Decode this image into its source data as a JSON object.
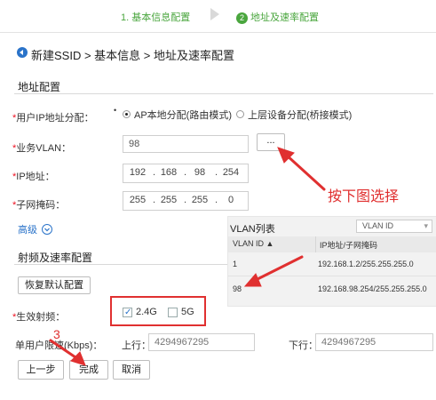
{
  "steps": {
    "step1_label": "1. 基本信息配置",
    "step2_number": "2",
    "step2_label": "地址及速率配置"
  },
  "breadcrumb": "新建SSID > 基本信息 > 地址及速率配置",
  "address_section": {
    "title": "地址配置",
    "ip_alloc_label": "用户IP地址分配：",
    "ip_alloc_options": [
      "AP本地分配(路由模式)",
      "上层设备分配(桥接模式)"
    ],
    "selected_ip_alloc": "AP本地分配(路由模式)",
    "vlan_label": "业务VLAN：",
    "vlan_value": "98",
    "vlan_picker_button": "...",
    "ip_label": "IP地址：",
    "ip_octets": [
      "192",
      "168",
      "98",
      "254"
    ],
    "mask_label": "子网掩码：",
    "mask_octets": [
      "255",
      "255",
      "255",
      "0"
    ],
    "advanced_label": "高级"
  },
  "rf_section": {
    "title": "射频及速率配置",
    "restore_button": "恢复默认配置",
    "band_label": "生效射频：",
    "band_options": [
      {
        "label": "2.4G",
        "checked": true
      },
      {
        "label": "5G",
        "checked": false
      }
    ],
    "rate_limit_label": "单用户限速(Kbps)：",
    "uplink_label": "上行：",
    "uplink_placeholder": "4294967295",
    "downlink_label": "下行：",
    "downlink_placeholder": "4294967295"
  },
  "vlan_list": {
    "title": "VLAN列表",
    "search_select": "VLAN ID",
    "columns": [
      "VLAN ID ▲",
      "IP地址/子网掩码"
    ],
    "rows": [
      {
        "vlan_id": "1",
        "ip_mask": "192.168.1.2/255.255.255.0"
      },
      {
        "vlan_id": "98",
        "ip_mask": "192.168.98.254/255.255.255.0"
      }
    ]
  },
  "footer_buttons": {
    "prev": "上一步",
    "finish": "完成",
    "cancel": "取消"
  },
  "annotations": {
    "click_note": "按下图选择",
    "step_number": "3",
    "annotation_color": "#e03030"
  },
  "colors": {
    "accent_green": "#4aa63e",
    "link_blue": "#2a73c9",
    "required_red": "#e11122"
  }
}
